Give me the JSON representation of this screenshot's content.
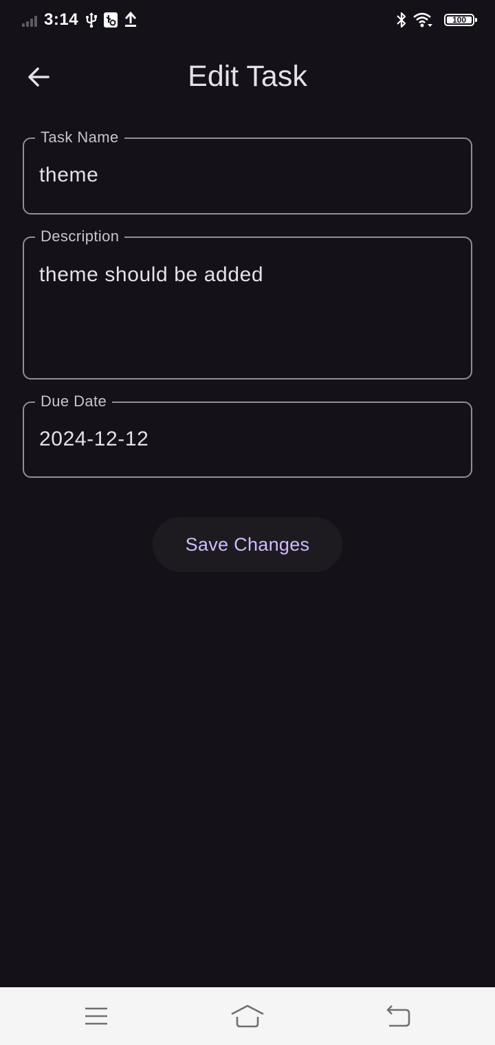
{
  "status_bar": {
    "time": "3:14",
    "battery_level": "100",
    "icons": [
      "signal-icon",
      "usb-icon",
      "usb-debug-icon",
      "upload-icon",
      "bluetooth-icon",
      "wifi-icon",
      "battery-icon"
    ]
  },
  "app_bar": {
    "title": "Edit Task",
    "back_icon": "arrow-left-icon"
  },
  "form": {
    "task_name": {
      "label": "Task Name",
      "value": "theme"
    },
    "description": {
      "label": "Description",
      "value": "theme should be added"
    },
    "due_date": {
      "label": "Due Date",
      "value": "2024-12-12"
    },
    "save_label": "Save Changes"
  },
  "nav_bar": {
    "icons": [
      "menu-icon",
      "home-icon",
      "back-icon"
    ]
  },
  "colors": {
    "background": "#141218",
    "on_surface": "#e6e0e9",
    "outline": "#938f99",
    "label": "#cac4d0",
    "primary": "#d0bcff",
    "button_surface": "#1d1b20",
    "nav_bar": "#f5f5f5"
  }
}
